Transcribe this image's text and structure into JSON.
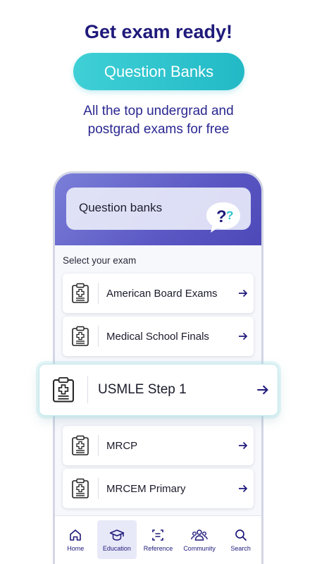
{
  "promo": {
    "headline": "Get exam ready!",
    "pill_label": "Question Banks",
    "subtitle_line1": "All the top undergrad and",
    "subtitle_line2": "postgrad exams for free"
  },
  "app": {
    "header_title": "Question banks",
    "bubble_icon": "question-speech-bubble-icon",
    "select_label": "Select your exam",
    "exams": [
      {
        "label": "American Board Exams",
        "icon": "clipboard-medical-icon"
      },
      {
        "label": "Medical School Finals",
        "icon": "clipboard-medical-icon"
      },
      {
        "label": "USMLE Step 1",
        "icon": "clipboard-medical-icon"
      },
      {
        "label": "MRCP",
        "icon": "clipboard-medical-icon"
      },
      {
        "label": "MRCEM Primary",
        "icon": "clipboard-medical-icon"
      }
    ],
    "nav": [
      {
        "label": "Home",
        "icon": "home-icon",
        "active": false
      },
      {
        "label": "Education",
        "icon": "graduation-cap-icon",
        "active": true
      },
      {
        "label": "Reference",
        "icon": "reference-scan-icon",
        "active": false
      },
      {
        "label": "Community",
        "icon": "community-icon",
        "active": false
      },
      {
        "label": "Search",
        "icon": "search-icon",
        "active": false
      }
    ]
  },
  "colors": {
    "headline": "#1f1a7a",
    "pill": "#2cc3cd",
    "header_gradient_start": "#7b7fd8",
    "header_gradient_end": "#4d49b8",
    "bubble_question_dark": "#1f1a7a",
    "bubble_question_accent": "#2cc3cd"
  }
}
